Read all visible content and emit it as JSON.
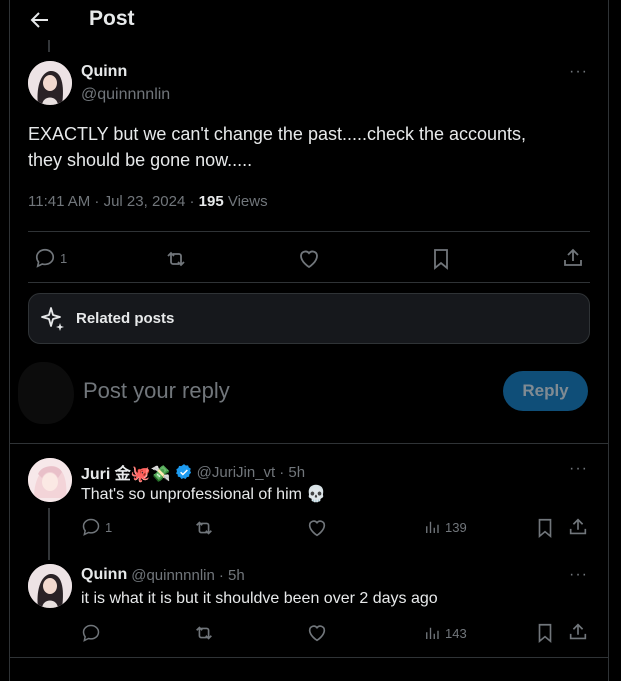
{
  "header": {
    "title": "Post",
    "back_icon": "arrow-left-icon"
  },
  "main_post": {
    "name": "Quinn",
    "handle": "@quinnnnlin",
    "text_line1": "EXACTLY but we can't change the past.....check the accounts,",
    "text_line2": "they should be gone now.....",
    "timestamp": "11:41 AM · Jul 23, 2024 · ",
    "views_count": "195",
    "views_label": " Views",
    "reply_count": "1",
    "more_label": "···"
  },
  "related": {
    "label": "Related posts",
    "icon": "sparkle-icon"
  },
  "composer": {
    "placeholder": "Post your reply",
    "reply_button": "Reply"
  },
  "replies": [
    {
      "name": "Juri 金🐙💸",
      "handle": "@JuriJin_vt",
      "time": " · 5h",
      "text": "That's so unprofessional of him 💀",
      "reply_count": "1",
      "views": "139",
      "verified": true
    },
    {
      "name": "Quinn",
      "handle": "@quinnnnlin",
      "time": " · 5h",
      "text": "it is what it is but it shouldve been over 2 days ago",
      "views": "143"
    }
  ],
  "colors": {
    "background": "#000000",
    "text": "#e7e9ea",
    "muted": "#71767b",
    "verified": "#1d9bf0",
    "reply_button": "#0f4e78"
  }
}
